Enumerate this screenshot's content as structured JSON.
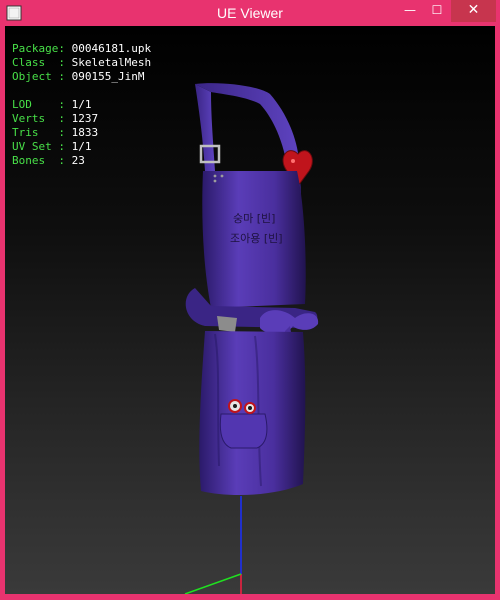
{
  "window": {
    "title": "UE Viewer",
    "controls": {
      "minimize": "—",
      "maximize": "☐",
      "close": "✕"
    }
  },
  "info": {
    "package": {
      "key": "Package: ",
      "value": "00046181.upk"
    },
    "class": {
      "key": "Class  : ",
      "value": "SkeletalMesh"
    },
    "object": {
      "key": "Object : ",
      "value": "090155_JinM"
    },
    "lod": {
      "key": "LOD    : ",
      "value": "1/1"
    },
    "verts": {
      "key": "Verts  : ",
      "value": "1237"
    },
    "tris": {
      "key": "Tris   : ",
      "value": "1833"
    },
    "uvset": {
      "key": "UV Set : ",
      "value": "1/1"
    },
    "bones": {
      "key": "Bones  : ",
      "value": "23"
    }
  },
  "model": {
    "apron_color": "#4a2f9e",
    "heart_color": "#c0141c",
    "pocket_text_line1": "숭마 [빈]",
    "pocket_text_line2": "조아용 [빈]"
  },
  "colors": {
    "frame": "#e8336f",
    "info_key": "#48e048",
    "info_value": "#ffffff",
    "axis_z": "#1a2fff",
    "axis_x": "#ff2020",
    "axis_y": "#20e020"
  }
}
